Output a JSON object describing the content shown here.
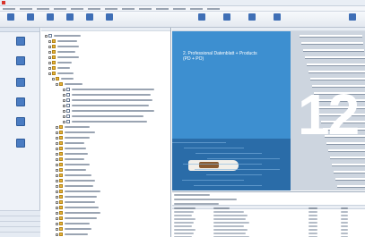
{
  "window": {
    "title": ""
  },
  "menu": [
    "",
    "",
    "",
    "",
    "",
    "",
    "",
    "",
    "",
    "",
    "",
    "",
    ""
  ],
  "toolbar": {
    "items": [
      {
        "label": "",
        "icon": "back-icon"
      },
      {
        "label": "",
        "icon": "forward-icon"
      },
      {
        "label": "",
        "icon": "refresh-icon"
      },
      {
        "label": "",
        "icon": "home-icon"
      },
      {
        "label": "",
        "icon": "search-icon"
      },
      {
        "label": "",
        "icon": "new-document-icon"
      },
      {
        "label": "",
        "icon": "print-icon"
      },
      {
        "label": "",
        "icon": "copy-icon"
      },
      {
        "label": "",
        "icon": "settings-icon"
      },
      {
        "label": "",
        "icon": "export-icon"
      },
      {
        "label": "",
        "icon": "properties-icon"
      }
    ]
  },
  "left_panel": {
    "items": [
      {
        "label": "",
        "icon": "folder-icon"
      },
      {
        "label": "",
        "icon": "catalog-icon"
      },
      {
        "label": "",
        "icon": "search-icon"
      },
      {
        "label": "",
        "icon": "document-icon"
      },
      {
        "label": "",
        "icon": "list-icon"
      },
      {
        "label": "",
        "icon": "tools-icon"
      }
    ],
    "footer": [
      "",
      "",
      "",
      "",
      ""
    ]
  },
  "tree": {
    "rows": [
      {
        "label": "",
        "icon": "doc"
      },
      {
        "label": "",
        "icon": "folder"
      },
      {
        "label": "",
        "icon": "folder"
      },
      {
        "label": "",
        "icon": "folder"
      },
      {
        "label": "",
        "icon": "folder"
      },
      {
        "label": "",
        "icon": "folder"
      },
      {
        "label": "",
        "icon": "folder"
      },
      {
        "label": "",
        "icon": "folder"
      },
      {
        "label": "",
        "icon": "folder"
      },
      {
        "label": "",
        "icon": "folder"
      },
      {
        "label": "",
        "icon": "doc"
      },
      {
        "label": "",
        "icon": "doc"
      },
      {
        "label": "",
        "icon": "doc"
      },
      {
        "label": "",
        "icon": "doc"
      },
      {
        "label": "",
        "icon": "doc"
      },
      {
        "label": "",
        "icon": "doc"
      },
      {
        "label": "",
        "icon": "doc"
      },
      {
        "label": "",
        "icon": "folder"
      },
      {
        "label": "",
        "icon": "folder"
      },
      {
        "label": "",
        "icon": "folder"
      },
      {
        "label": "",
        "icon": "folder"
      },
      {
        "label": "",
        "icon": "folder"
      },
      {
        "label": "",
        "icon": "folder"
      },
      {
        "label": "",
        "icon": "folder"
      },
      {
        "label": "",
        "icon": "folder"
      },
      {
        "label": "",
        "icon": "folder"
      },
      {
        "label": "",
        "icon": "folder"
      },
      {
        "label": "",
        "icon": "folder"
      },
      {
        "label": "",
        "icon": "folder"
      },
      {
        "label": "",
        "icon": "folder"
      },
      {
        "label": "",
        "icon": "folder"
      },
      {
        "label": "",
        "icon": "folder"
      },
      {
        "label": "",
        "icon": "folder"
      },
      {
        "label": "",
        "icon": "folder"
      },
      {
        "label": "",
        "icon": "folder"
      },
      {
        "label": "",
        "icon": "folder"
      },
      {
        "label": "",
        "icon": "folder"
      },
      {
        "label": "",
        "icon": "folder"
      }
    ]
  },
  "preview": {
    "cover_title_line1": "2. Professional Datenblatt + Products",
    "cover_title_line2": "(PD + PO)",
    "cover_digits": "12"
  },
  "details": {
    "meta_lines": [
      "",
      "",
      ""
    ],
    "columns": [
      "",
      "",
      "",
      ""
    ],
    "rows": [
      [
        "",
        "",
        "",
        ""
      ],
      [
        "",
        "",
        "",
        ""
      ],
      [
        "",
        "",
        "",
        ""
      ],
      [
        "",
        "",
        "",
        ""
      ],
      [
        "",
        "",
        "",
        ""
      ],
      [
        "",
        "",
        "",
        ""
      ],
      [
        "",
        "",
        "",
        ""
      ],
      [
        "",
        "",
        "",
        ""
      ]
    ]
  },
  "colors": {
    "accent": "#2f7fc4",
    "cover_blue": "#3d8fd0",
    "folder": "#e6b33a"
  }
}
